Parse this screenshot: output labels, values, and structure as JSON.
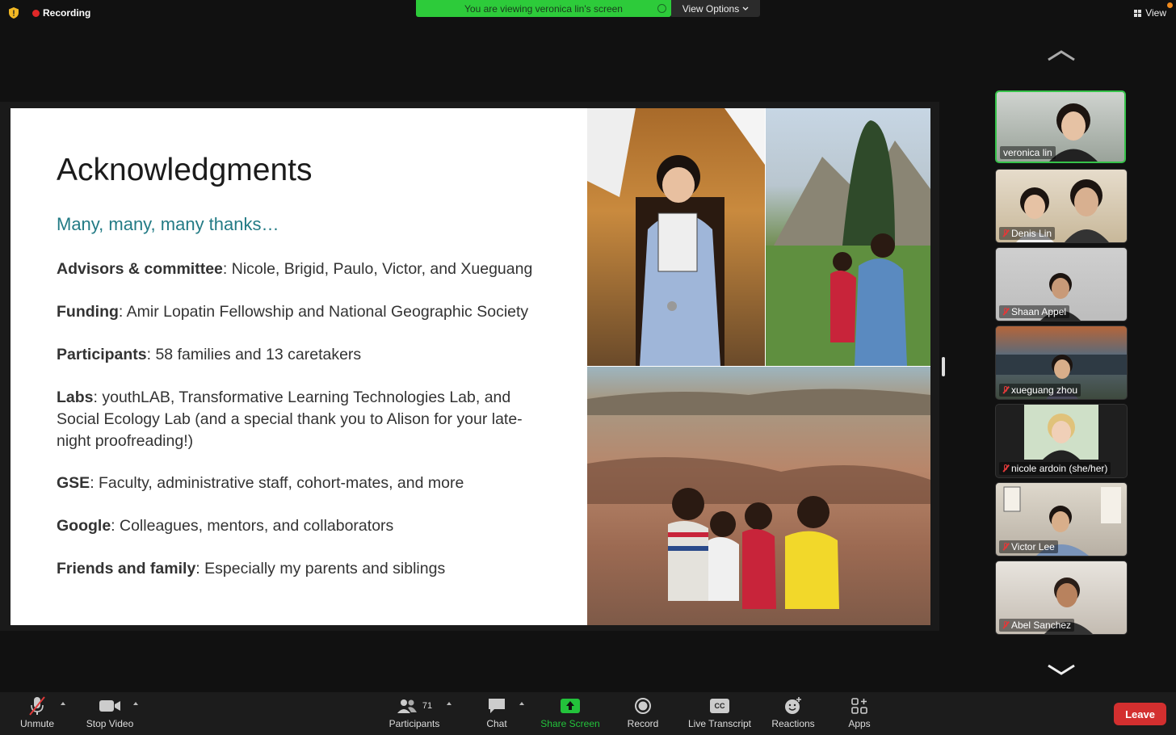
{
  "top": {
    "recording_label": "Recording",
    "banner_text": "You are viewing veronica lin's screen",
    "view_options_label": "View Options",
    "view_label": "View"
  },
  "slide": {
    "title": "Acknowledgments",
    "subtitle": "Many, many, many thanks…",
    "items": [
      {
        "head": "Advisors & committee",
        "text": ": Nicole, Brigid, Paulo, Victor, and Xueguang"
      },
      {
        "head": "Funding",
        "text": ": Amir Lopatin Fellowship and National Geographic Society"
      },
      {
        "head": "Participants",
        "text": ": 58 families and 13 caretakers"
      },
      {
        "head": "Labs",
        "text": ": youthLAB, Transformative Learning Technologies Lab, and Social Ecology Lab (and a special thank you to Alison for your late-night proofreading!)"
      },
      {
        "head": "GSE",
        "text": ": Faculty, administrative staff, cohort-mates, and more"
      },
      {
        "head": "Google",
        "text": ": Colleagues, mentors, and collaborators"
      },
      {
        "head": "Friends and family",
        "text": ": Especially my parents and siblings"
      }
    ]
  },
  "participants": [
    {
      "name": "veronica lin",
      "muted": false,
      "active": true
    },
    {
      "name": "Denis Lin",
      "muted": true,
      "active": false
    },
    {
      "name": "Shaan Appel",
      "muted": true,
      "active": false
    },
    {
      "name": "xueguang zhou",
      "muted": true,
      "active": false
    },
    {
      "name": "nicole ardoin (she/her)",
      "muted": true,
      "active": false
    },
    {
      "name": "Victor Lee",
      "muted": true,
      "active": false
    },
    {
      "name": "Abel Sanchez",
      "muted": true,
      "active": false
    }
  ],
  "toolbar": {
    "unmute": "Unmute",
    "stop_video": "Stop Video",
    "participants": "Participants",
    "participant_count": "71",
    "chat": "Chat",
    "share_screen": "Share Screen",
    "record": "Record",
    "live_transcript": "Live Transcript",
    "cc": "CC",
    "reactions": "Reactions",
    "apps": "Apps",
    "leave": "Leave"
  },
  "colors": {
    "banner_green": "#2dcb3a",
    "share_green": "#23c23b",
    "leave_red": "#d32f2f",
    "subtitle_teal": "#237b85",
    "active_border": "#36c24a"
  }
}
